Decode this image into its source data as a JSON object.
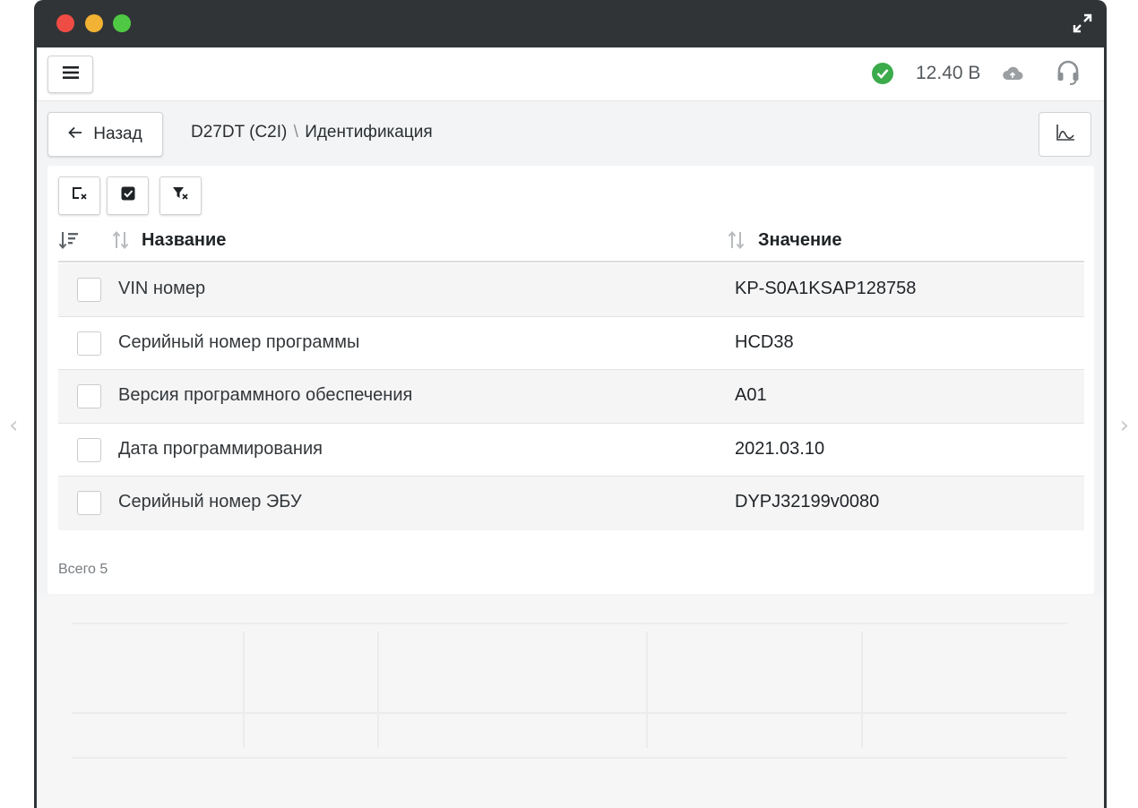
{
  "window": {
    "title_controls": [
      "close",
      "minimize",
      "zoom"
    ]
  },
  "topbar": {
    "voltage": "12.40 В",
    "status_color": "#3cab4b"
  },
  "nav": {
    "back_label": "Назад",
    "breadcrumb_ecu": "D27DT (C2I)",
    "breadcrumb_separator": "\\",
    "breadcrumb_page": "Идентификация"
  },
  "table": {
    "columns": {
      "name": "Название",
      "value": "Значение"
    },
    "rows": [
      {
        "name": "VIN номер",
        "value": "KP-S0A1KSAP128758"
      },
      {
        "name": "Серийный номер программы",
        "value": "HCD38"
      },
      {
        "name": "Версия программного обеспечения",
        "value": "A01"
      },
      {
        "name": "Дата программирования",
        "value": "2021.03.10"
      },
      {
        "name": "Серийный номер ЭБУ",
        "value": "DYPJ32199v0080"
      }
    ],
    "total_label": "Всего 5"
  },
  "icons": {
    "menu": "hamburger-icon",
    "status": "check-circle-icon",
    "cloud": "cloud-upload-icon",
    "support": "headset-icon",
    "back": "arrow-left-icon",
    "chart": "line-chart-icon",
    "clear_selection": "clear-selection-icon",
    "select_all": "select-all-icon",
    "clear_filter": "clear-filter-icon",
    "sort_all": "sort-desc-icon",
    "sort_column": "sort-icon",
    "expand": "expand-icon",
    "prev": "chevron-left-icon",
    "next": "chevron-right-icon"
  }
}
